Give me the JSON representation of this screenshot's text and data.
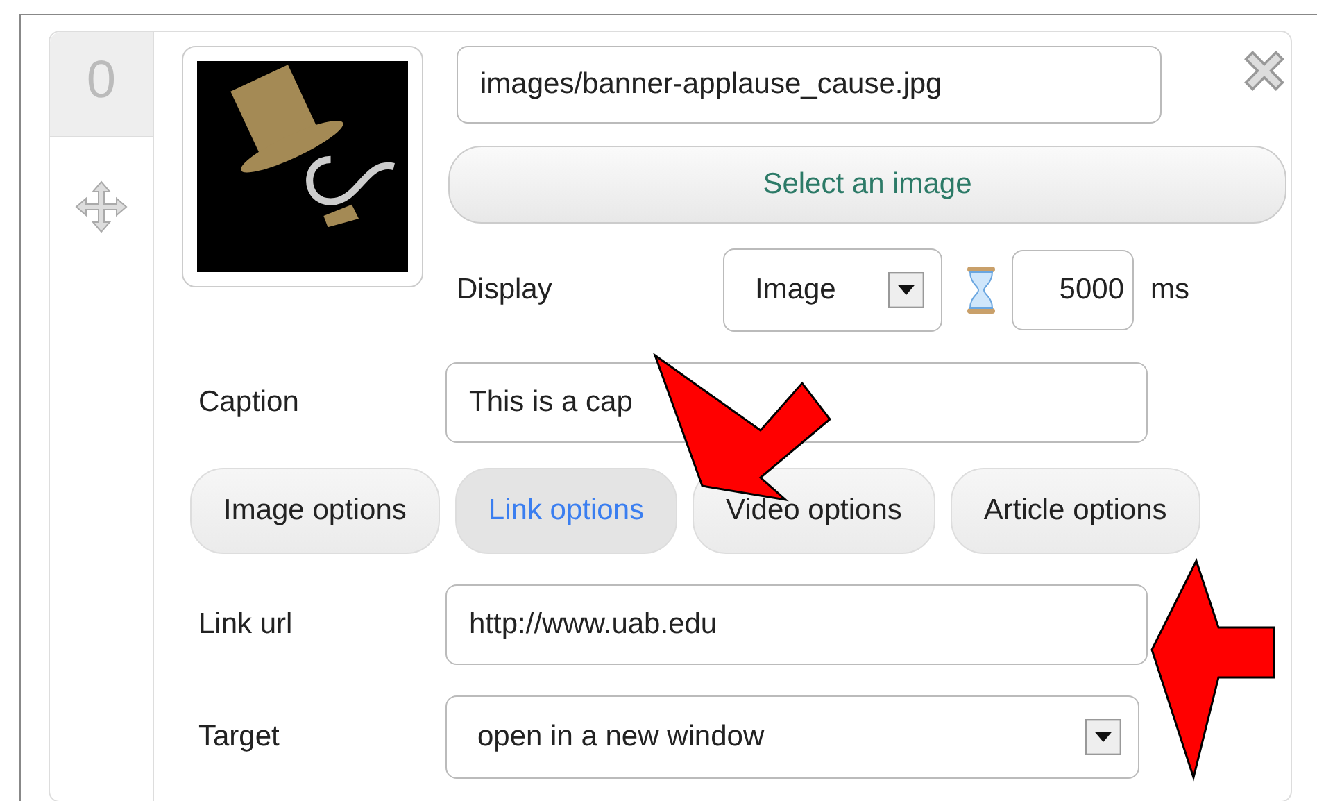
{
  "item_number": "0",
  "image": {
    "path": "images/banner-applause_cause.jpg",
    "select_button": "Select an image"
  },
  "display": {
    "label": "Display",
    "value": "Image",
    "duration": "5000",
    "unit": "ms"
  },
  "caption": {
    "label": "Caption",
    "value": "This is a cap"
  },
  "option_tabs": [
    {
      "label": "Image options",
      "selected": false
    },
    {
      "label": "Link options",
      "selected": true
    },
    {
      "label": "Video options",
      "selected": false
    },
    {
      "label": "Article options",
      "selected": false
    }
  ],
  "link_url": {
    "label": "Link url",
    "value": "http://www.uab.edu"
  },
  "target": {
    "label": "Target",
    "value": "open in a new window"
  }
}
